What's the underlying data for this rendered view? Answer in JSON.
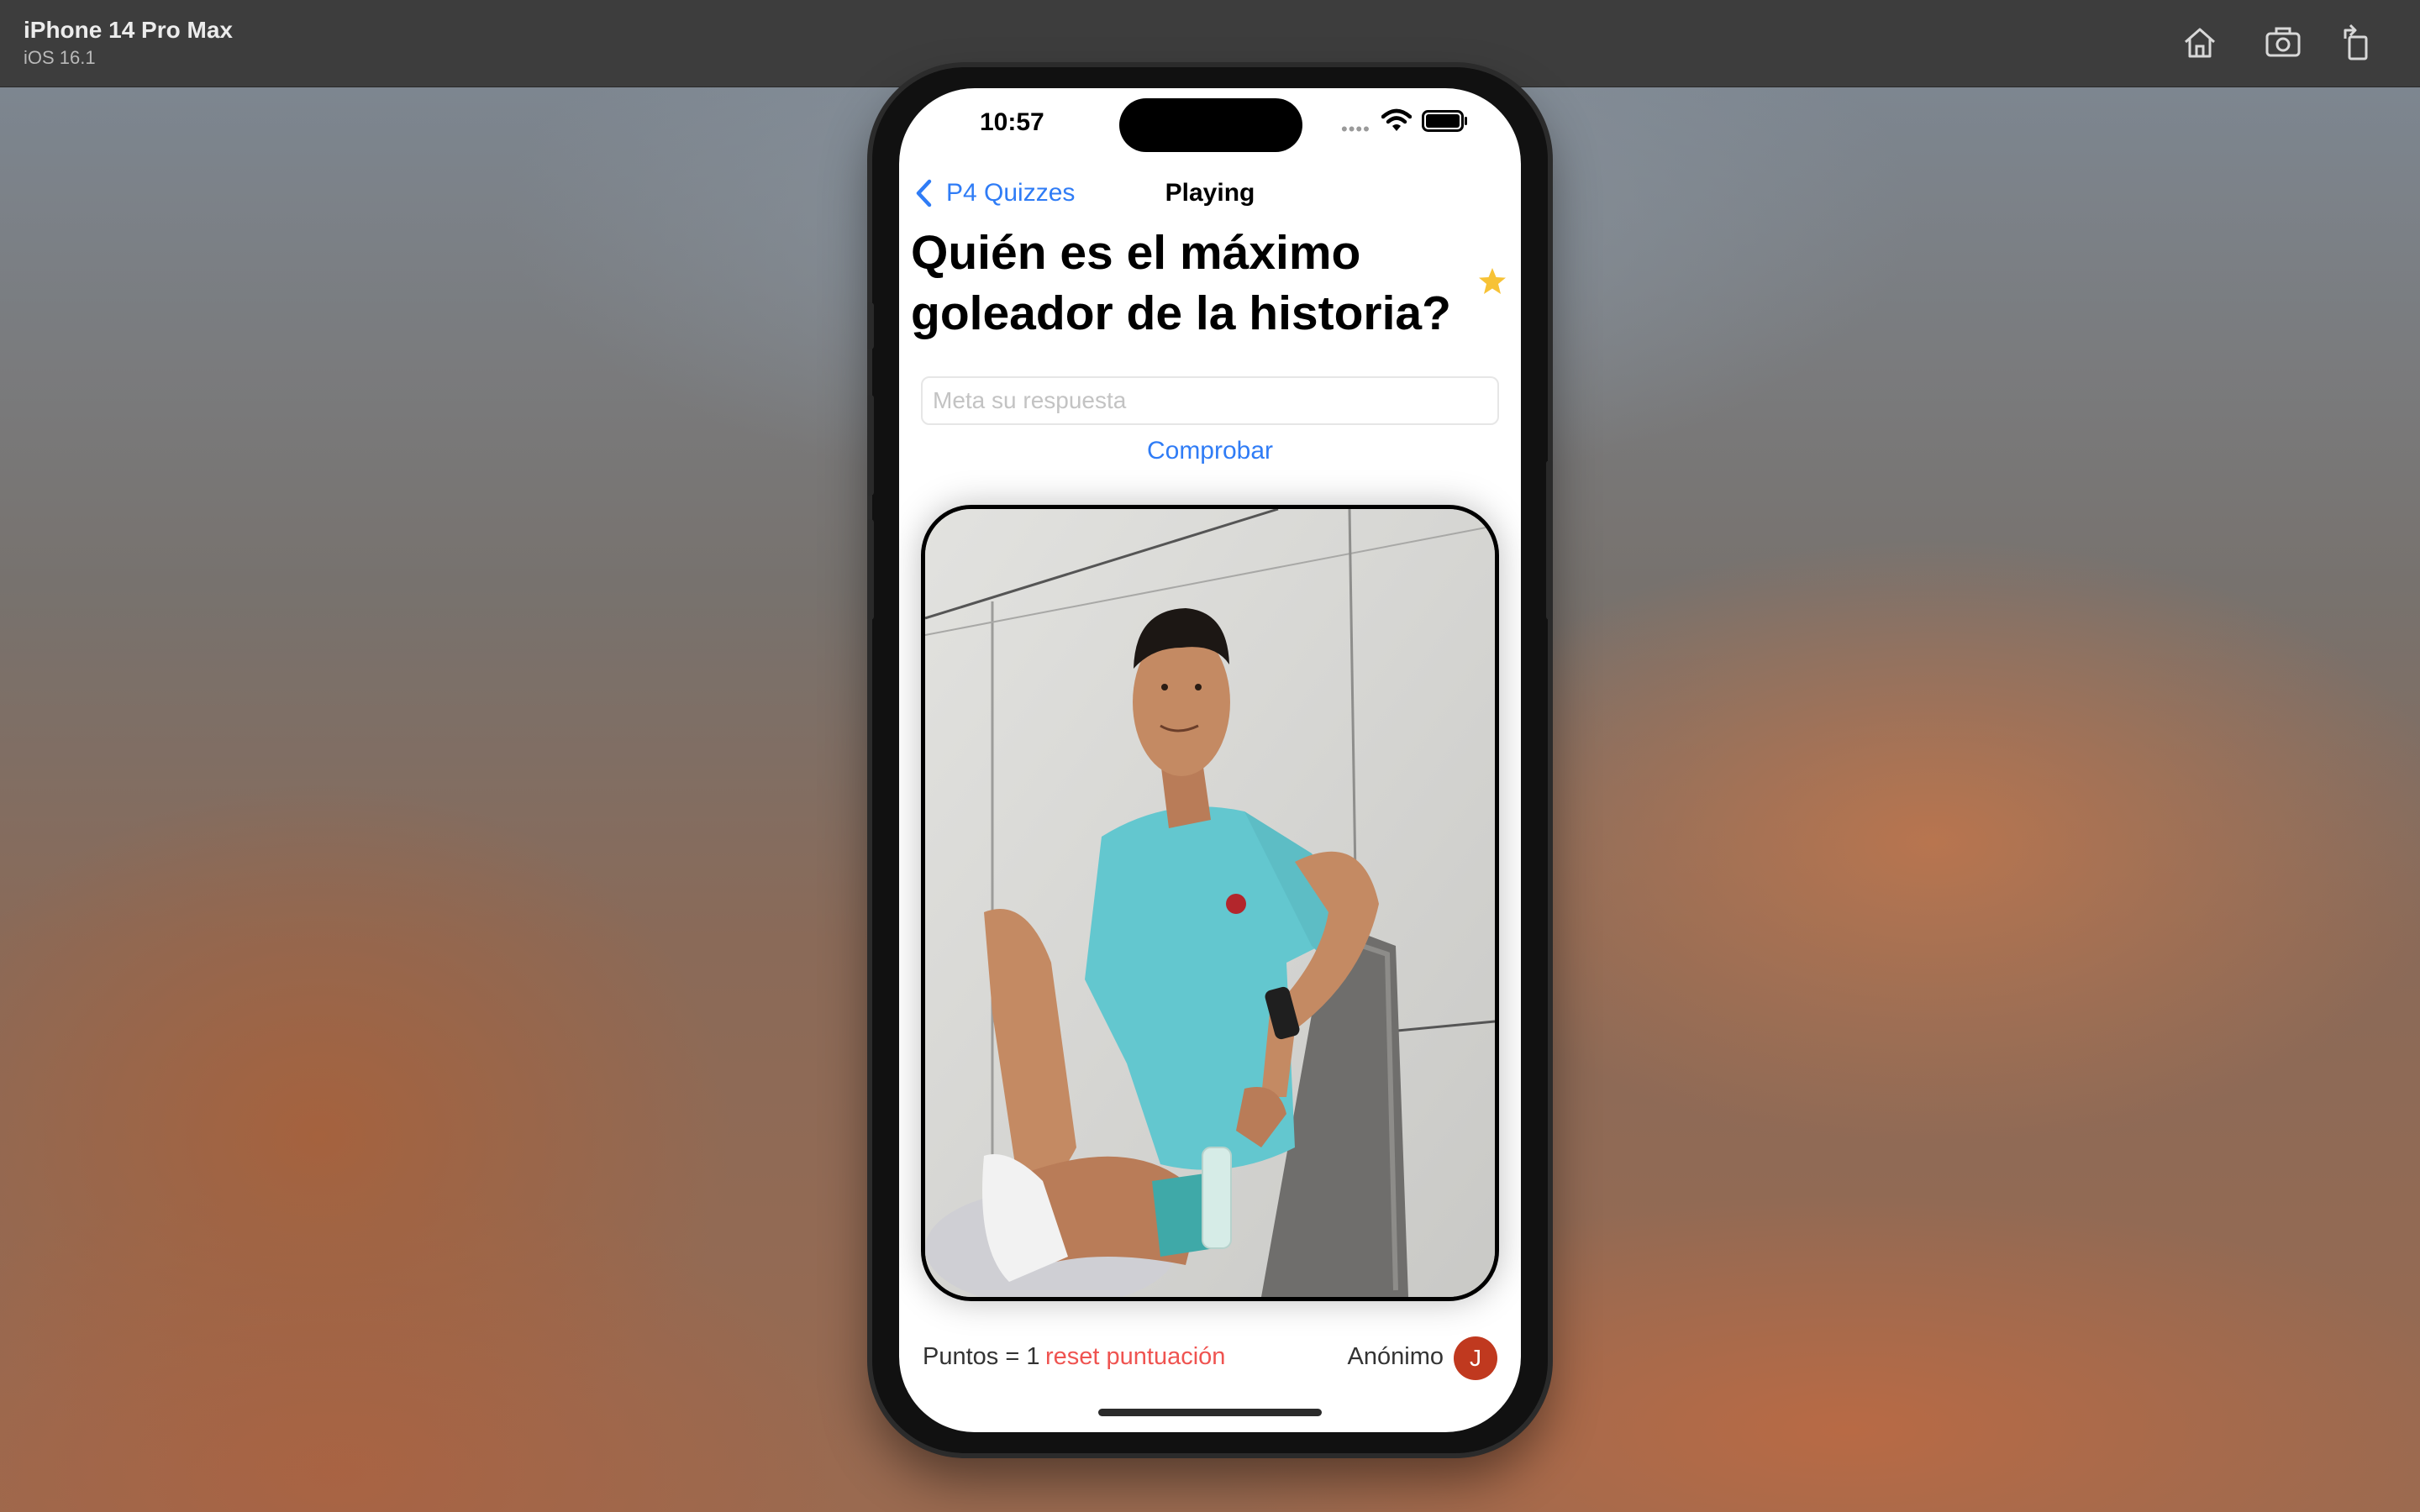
{
  "simulator": {
    "device_name": "iPhone 14 Pro Max",
    "os_version": "iOS 16.1",
    "toolbar_icons": [
      "home-icon",
      "screenshot-icon",
      "rotate-icon"
    ]
  },
  "status_bar": {
    "time": "10:57",
    "icons": [
      "signal-dots-icon",
      "wifi-icon",
      "battery-icon"
    ]
  },
  "nav": {
    "back_label": "P4 Quizzes",
    "title": "Playing"
  },
  "quiz": {
    "question": "Quién es el máximo goleador de la historia?",
    "favorite_icon": "star-icon",
    "favorite_color": "#f7c236",
    "answer_placeholder": "Meta su respuesta",
    "answer_value": "",
    "check_label": "Comprobar"
  },
  "footer": {
    "points_text": "Puntos = 1",
    "reset_label": "reset puntuación",
    "user_name": "Anónimo",
    "avatar_initial": "J",
    "avatar_color": "#c0391f"
  },
  "colors": {
    "accent": "#2f7cf6",
    "reset": "#ef5350"
  }
}
